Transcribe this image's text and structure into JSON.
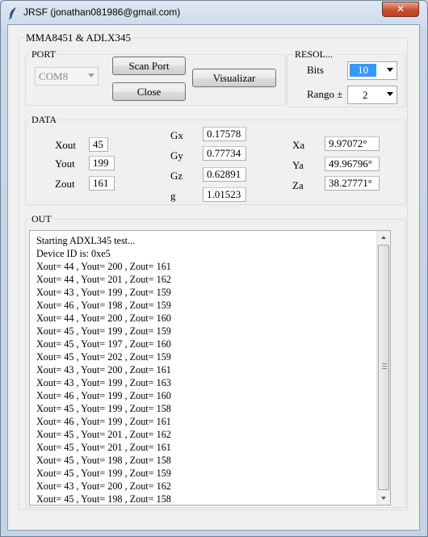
{
  "window": {
    "title": "JRSF (jonathan081986@gmail.com)",
    "close_glyph": "✕"
  },
  "main_group": {
    "label": "MMA8451 & ADLX345"
  },
  "port": {
    "label": "PORT",
    "com_value": "COM8",
    "scan_label": "Scan Port",
    "close_label": "Close",
    "visualizar_label": "Visualizar"
  },
  "resol": {
    "label": "RESOL...",
    "bits_label": "Bits",
    "bits_value": "10",
    "rango_label": "Rango ±",
    "rango_value": "2"
  },
  "data": {
    "label": "DATA",
    "xout_label": "Xout",
    "xout": "45",
    "yout_label": "Yout",
    "yout": "199",
    "zout_label": "Zout",
    "zout": "161",
    "gx_label": "Gx",
    "gx": "0.17578",
    "gy_label": "Gy",
    "gy": "0.77734",
    "gz_label": "Gz",
    "gz": "0.62891",
    "g_label": "g",
    "g": "1.01523",
    "xa_label": "Xa",
    "xa": "9.97072°",
    "ya_label": "Ya",
    "ya": "49.96796°",
    "za_label": "Za",
    "za": "38.27771°"
  },
  "out": {
    "label": "OUT",
    "lines": [
      "Starting ADXL345 test...",
      "Device ID is: 0xe5",
      "Xout= 44 , Yout= 200 , Zout= 161",
      "Xout= 44 , Yout= 201 , Zout= 162",
      "Xout= 43 , Yout= 199 , Zout= 159",
      "Xout= 46 , Yout= 198 , Zout= 159",
      "Xout= 44 , Yout= 200 , Zout= 160",
      "Xout= 45 , Yout= 199 , Zout= 159",
      "Xout= 45 , Yout= 197 , Zout= 160",
      "Xout= 45 , Yout= 202 , Zout= 159",
      "Xout= 43 , Yout= 200 , Zout= 161",
      "Xout= 43 , Yout= 199 , Zout= 163",
      "Xout= 46 , Yout= 199 , Zout= 160",
      "Xout= 45 , Yout= 199 , Zout= 158",
      "Xout= 46 , Yout= 199 , Zout= 161",
      "Xout= 45 , Yout= 201 , Zout= 162",
      "Xout= 45 , Yout= 201 , Zout= 161",
      "Xout= 45 , Yout= 198 , Zout= 158",
      "Xout= 45 , Yout= 199 , Zout= 159",
      "Xout= 43 , Yout= 200 , Zout= 162",
      "Xout= 45 , Yout= 198 , Zout= 158"
    ]
  },
  "icons": {
    "app": "feather-icon",
    "close": "close-icon",
    "dropdown": "chevron-down-icon"
  },
  "colors": {
    "close_button": "#c7502e",
    "selection": "#3399ff"
  }
}
